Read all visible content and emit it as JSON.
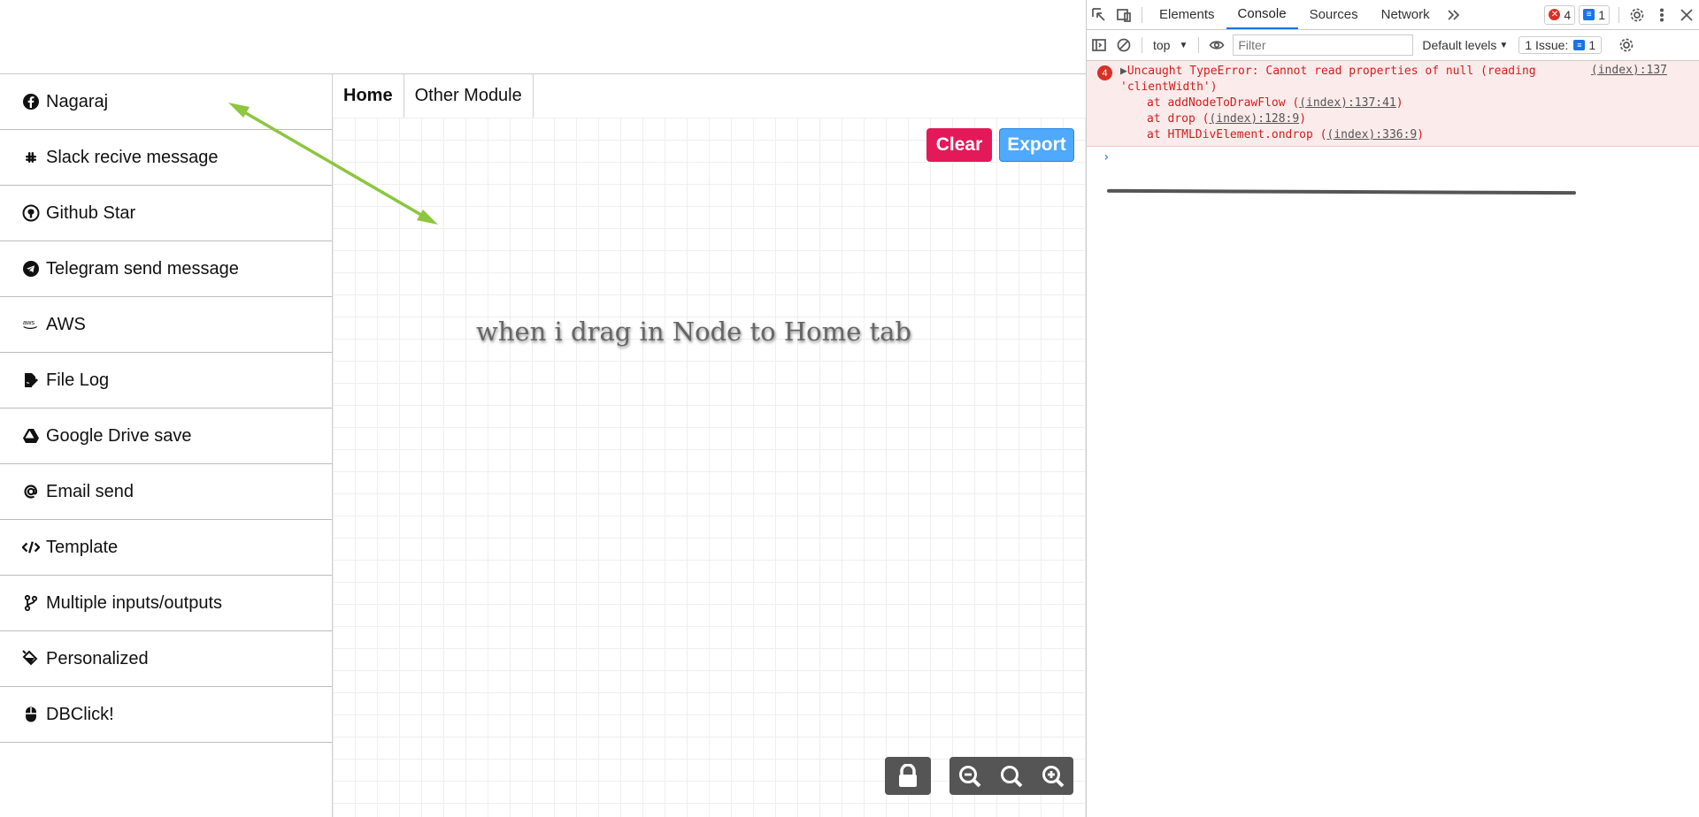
{
  "sidebar": {
    "items": [
      {
        "label": "Nagaraj",
        "icon": "facebook-icon"
      },
      {
        "label": "Slack recive message",
        "icon": "slack-icon"
      },
      {
        "label": "Github Star",
        "icon": "github-icon"
      },
      {
        "label": "Telegram send message",
        "icon": "telegram-icon"
      },
      {
        "label": "AWS",
        "icon": "aws-icon"
      },
      {
        "label": "File Log",
        "icon": "file-signature-icon"
      },
      {
        "label": "Google Drive save",
        "icon": "google-drive-icon"
      },
      {
        "label": "Email send",
        "icon": "at-icon"
      },
      {
        "label": "Template",
        "icon": "code-icon"
      },
      {
        "label": "Multiple inputs/outputs",
        "icon": "code-branch-icon"
      },
      {
        "label": "Personalized",
        "icon": "fill-icon"
      },
      {
        "label": "DBClick!",
        "icon": "mouse-icon"
      }
    ]
  },
  "main": {
    "tabs": [
      {
        "label": "Home",
        "active": true
      },
      {
        "label": "Other Module",
        "active": false
      }
    ],
    "clear_label": "Clear",
    "export_label": "Export",
    "annotation": "when i drag in Node to Home tab",
    "colors": {
      "clear": "#e3195a",
      "export": "#4ea9ff",
      "arrow": "#8dc63f",
      "controls": "#555555"
    }
  },
  "devtools": {
    "tabs": [
      "Elements",
      "Console",
      "Sources",
      "Network"
    ],
    "active_tab": "Console",
    "error_badge_count": "4",
    "message_badge_count": "1",
    "context": "top",
    "filter_placeholder": "Filter",
    "levels": "Default levels",
    "issues_label": "1 Issue:",
    "issues_count": "1",
    "error": {
      "count": "4",
      "message_line1": "Uncaught TypeError: Cannot read properties of null (reading",
      "message_line2": "'clientWidth')",
      "source": "(index):137",
      "stack": [
        {
          "prefix": "at addNodeToDrawFlow (",
          "link": "(index):137:41",
          "suffix": ")"
        },
        {
          "prefix": "at drop (",
          "link": "(index):128:9",
          "suffix": ")"
        },
        {
          "prefix": "at HTMLDivElement.ondrop (",
          "link": "(index):336:9",
          "suffix": ")"
        }
      ]
    },
    "prompt": "›"
  }
}
